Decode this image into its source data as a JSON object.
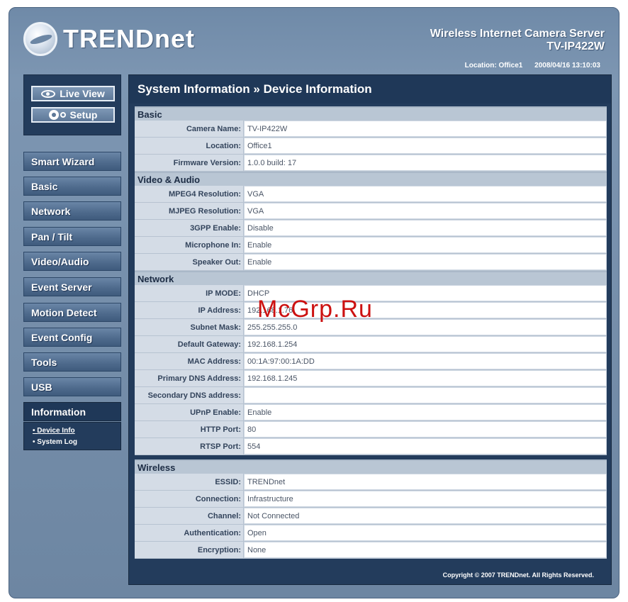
{
  "header": {
    "brand": "TRENDnet",
    "product_name": "Wireless Internet Camera Server",
    "product_model": "TV-IP422W",
    "location": "Location: Office1",
    "datetime": "2008/04/16 13:10:03"
  },
  "sidebar": {
    "live_view": "Live View",
    "setup": "Setup",
    "items": [
      {
        "label": "Smart Wizard"
      },
      {
        "label": "Basic"
      },
      {
        "label": "Network"
      },
      {
        "label": "Pan / Tilt"
      },
      {
        "label": "Video/Audio"
      },
      {
        "label": "Event Server"
      },
      {
        "label": "Motion Detect"
      },
      {
        "label": "Event Config"
      },
      {
        "label": "Tools"
      },
      {
        "label": "USB"
      },
      {
        "label": "Information"
      }
    ],
    "submenu": [
      "• Device Info",
      "• System Log"
    ]
  },
  "main": {
    "title": "System Information » Device Information",
    "sections": [
      {
        "title": "Basic",
        "rows": [
          {
            "label": "Camera Name:",
            "value": "TV-IP422W"
          },
          {
            "label": "Location:",
            "value": "Office1"
          },
          {
            "label": "Firmware Version:",
            "value": "1.0.0 build: 17"
          }
        ]
      },
      {
        "title": "Video & Audio",
        "rows": [
          {
            "label": "MPEG4 Resolution:",
            "value": "VGA"
          },
          {
            "label": "MJPEG Resolution:",
            "value": "VGA"
          },
          {
            "label": "3GPP Enable:",
            "value": "Disable"
          },
          {
            "label": "Microphone In:",
            "value": "Enable"
          },
          {
            "label": "Speaker Out:",
            "value": "Enable"
          }
        ]
      },
      {
        "title": "Network",
        "rows": [
          {
            "label": "IP MODE:",
            "value": "DHCP"
          },
          {
            "label": "IP Address:",
            "value": "192.168.1.76"
          },
          {
            "label": "Subnet Mask:",
            "value": "255.255.255.0"
          },
          {
            "label": "Default Gateway:",
            "value": "192.168.1.254"
          },
          {
            "label": "MAC Address:",
            "value": "00:1A:97:00:1A:DD"
          },
          {
            "label": "Primary DNS Address:",
            "value": "192.168.1.245"
          },
          {
            "label": "Secondary DNS address:",
            "value": ""
          },
          {
            "label": "UPnP Enable:",
            "value": "Enable"
          },
          {
            "label": "HTTP Port:",
            "value": "80"
          },
          {
            "label": "RTSP Port:",
            "value": "554"
          }
        ]
      },
      {
        "title": "Wireless",
        "rows": [
          {
            "label": "ESSID:",
            "value": "TRENDnet"
          },
          {
            "label": "Connection:",
            "value": "Infrastructure"
          },
          {
            "label": "Channel:",
            "value": "Not Connected"
          },
          {
            "label": "Authentication:",
            "value": "Open"
          },
          {
            "label": "Encryption:",
            "value": "None"
          }
        ]
      }
    ]
  },
  "footer": {
    "copyright": "Copyright © 2007 TRENDnet. All Rights Reserved."
  },
  "watermark": "McGrp.Ru",
  "colors": {
    "frame": "#6f8aa8",
    "panel": "#233c5c",
    "section_header": "#b9c6d4",
    "label_cell": "#d4dce6"
  }
}
